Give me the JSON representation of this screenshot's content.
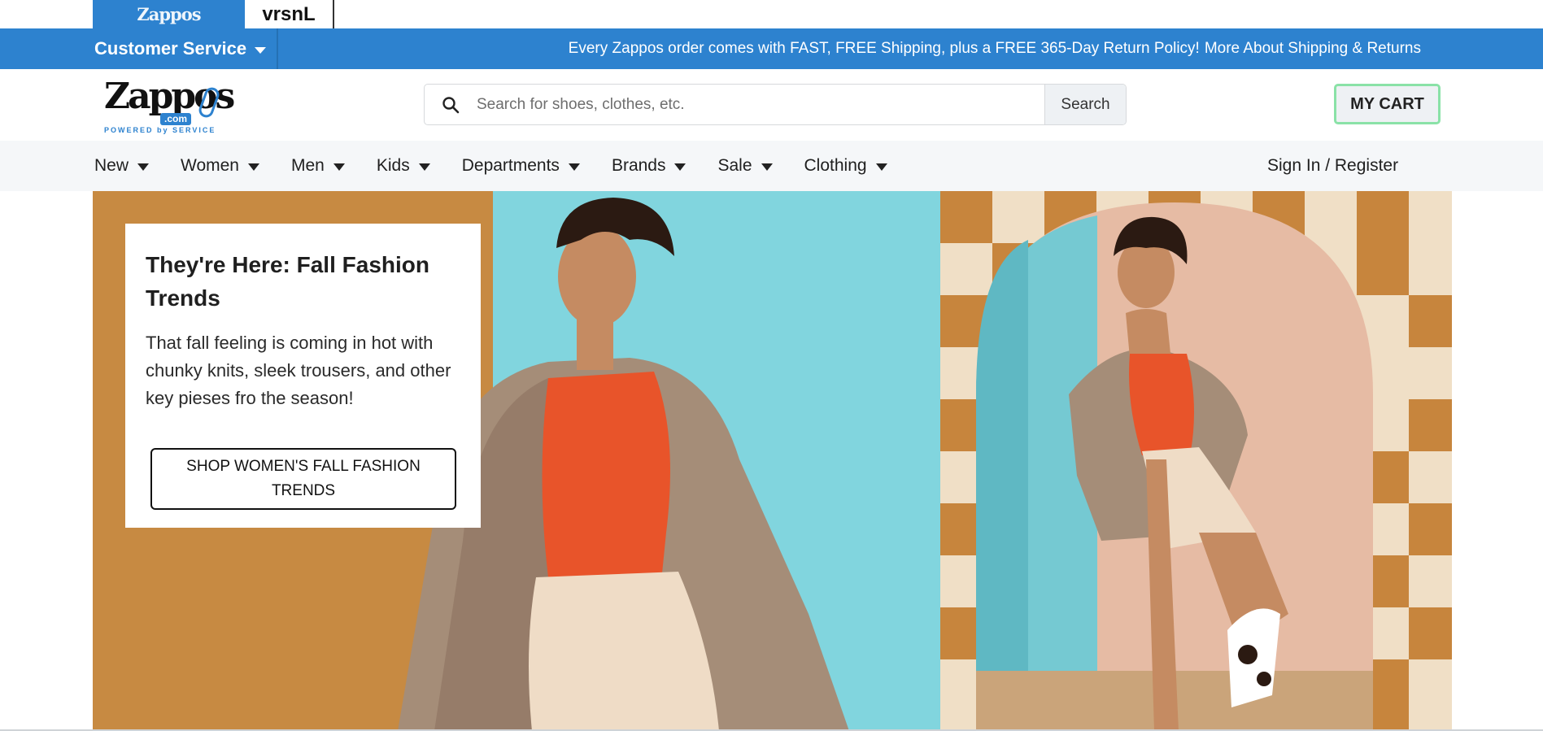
{
  "site_tabs": {
    "logo_text": "Zappos",
    "text_tab": "vrsnL"
  },
  "cs_bar": {
    "menu_label": "Customer Service",
    "promo_text": "Every Zappos order comes with FAST, FREE Shipping, plus a FREE 365-Day Return Policy!",
    "promo_link": "More About Shipping & Returns",
    "background": "#2d82cf"
  },
  "header": {
    "logo_word": "Zappos",
    "logo_com": ".com",
    "logo_tagline": "POWERED by SERVICE",
    "search_placeholder": "Search for shoes, clothes, etc.",
    "search_button": "Search",
    "cart_button": "MY CART"
  },
  "nav": {
    "items": [
      {
        "label": "New"
      },
      {
        "label": "Women"
      },
      {
        "label": "Men"
      },
      {
        "label": "Kids"
      },
      {
        "label": "Departments"
      },
      {
        "label": "Brands"
      },
      {
        "label": "Sale"
      },
      {
        "label": "Clothing"
      }
    ],
    "sign_in": "Sign In / Register"
  },
  "hero": {
    "title": "They're Here: Fall Fashion Trends",
    "text": "That fall feeling is coming in hot with chunky knits, sleek trousers, and other key pieses fro the season!",
    "cta": "SHOP WOMEN'S FALL FASHION TRENDS"
  },
  "colors": {
    "accent_blue": "#2d82cf",
    "cart_border": "#8ae2a7",
    "nav_bg": "#f5f7f9",
    "hero_tan": "#c78a42",
    "hero_teal": "#7ad3dc",
    "hero_orange": "#e8542a"
  },
  "icons": {
    "search": "search-icon",
    "caret": "chevron-down-icon"
  }
}
